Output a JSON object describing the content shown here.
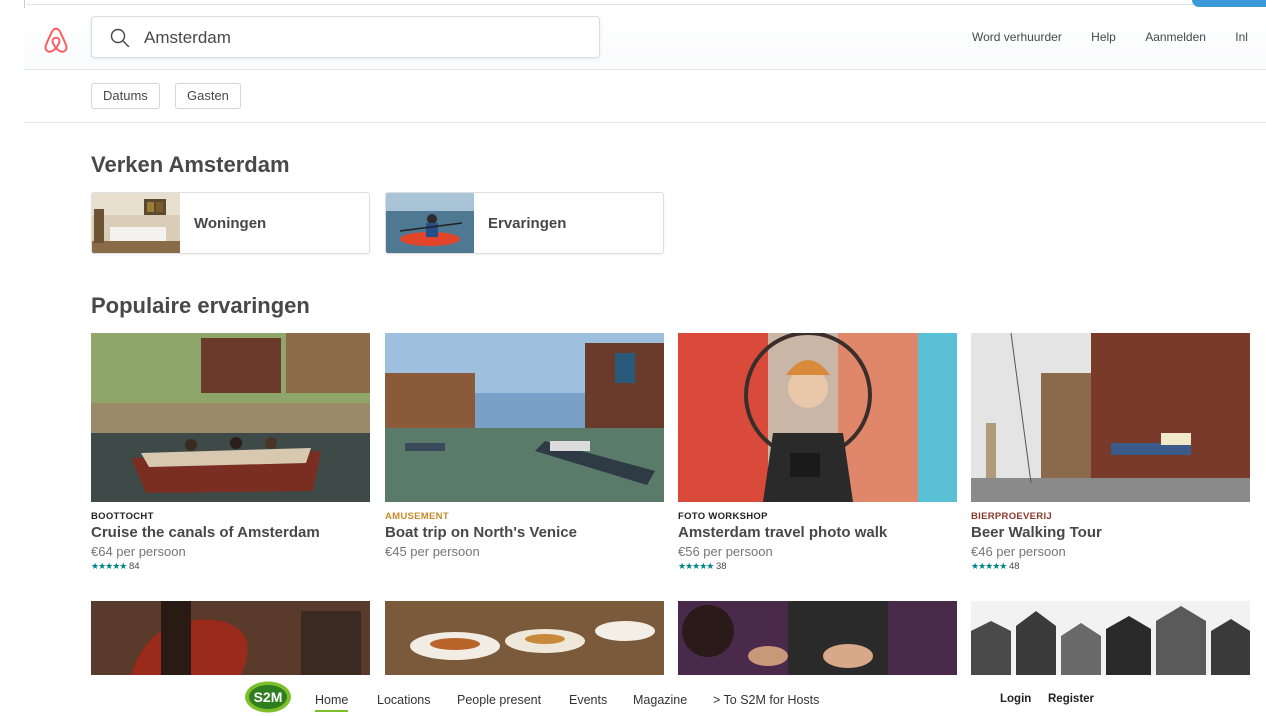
{
  "header": {
    "search_value": "Amsterdam",
    "nav": [
      "Word verhuurder",
      "Help",
      "Aanmelden",
      "Inl"
    ]
  },
  "filters": [
    "Datums",
    "Gasten"
  ],
  "explore": {
    "title": "Verken Amsterdam",
    "tiles": [
      "Woningen",
      "Ervaringen"
    ]
  },
  "popular": {
    "title": "Populaire ervaringen",
    "cards": [
      {
        "category": "BOOTTOCHT",
        "category_color": "#222222",
        "title": "Cruise the canals of Amsterdam",
        "price": "€64 per persoon",
        "stars": "★★★★★",
        "reviews": "84"
      },
      {
        "category": "AMUSEMENT",
        "category_color": "#c88a2b",
        "title": "Boat trip on North's Venice",
        "price": "€45 per persoon",
        "stars": "",
        "reviews": ""
      },
      {
        "category": "FOTO WORKSHOP",
        "category_color": "#222222",
        "title": "Amsterdam travel photo walk",
        "price": "€56 per persoon",
        "stars": "★★★★★",
        "reviews": "38"
      },
      {
        "category": "BIERPROEVERIJ",
        "category_color": "#8a3a2a",
        "title": "Beer Walking Tour",
        "price": "€46 per persoon",
        "stars": "★★★★★",
        "reviews": "48"
      }
    ]
  },
  "footer": {
    "logo_text": "S2M",
    "nav": [
      "Home",
      "Locations",
      "People present",
      "Events",
      "Magazine",
      "> To S2M for Hosts"
    ],
    "login": "Login",
    "register": "Register"
  },
  "colors": {
    "brand": "#ff5a5f",
    "teal": "#008489",
    "s2m_green": "#7cbf29"
  }
}
